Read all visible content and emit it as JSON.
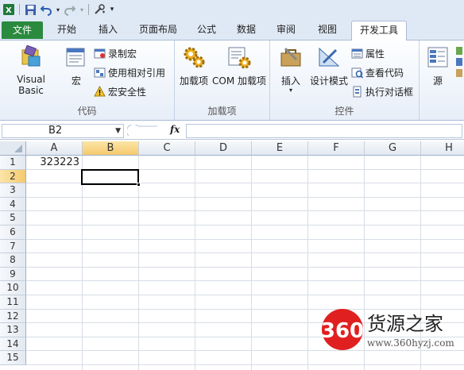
{
  "qat": {
    "icons": [
      "excel-icon",
      "save-icon",
      "undo-icon",
      "redo-icon",
      "customize-icon"
    ]
  },
  "tabs": [
    {
      "label": "文件"
    },
    {
      "label": "开始"
    },
    {
      "label": "插入"
    },
    {
      "label": "页面布局"
    },
    {
      "label": "公式"
    },
    {
      "label": "数据"
    },
    {
      "label": "审阅"
    },
    {
      "label": "视图"
    },
    {
      "label": "开发工具"
    }
  ],
  "ribbon": {
    "code_group": {
      "label": "代码",
      "visual_basic": "Visual Basic",
      "macros": "宏",
      "record_macro": "录制宏",
      "relative_refs": "使用相对引用",
      "macro_security": "宏安全性"
    },
    "addins_group": {
      "label": "加载项",
      "addins": "加载项",
      "com_addins": "COM 加载项"
    },
    "controls_group": {
      "label": "控件",
      "insert": "插入",
      "design_mode": "设计模式",
      "properties": "属性",
      "view_code": "查看代码",
      "run_dialog": "执行对话框"
    },
    "xml_group": {
      "source": "源"
    }
  },
  "formula_bar": {
    "name_box": "B2",
    "fx": "fx",
    "formula": ""
  },
  "grid": {
    "columns": [
      "A",
      "B",
      "C",
      "D",
      "E",
      "F",
      "G",
      "H"
    ],
    "rows": [
      "1",
      "2",
      "3",
      "4",
      "5",
      "6",
      "7",
      "8",
      "9",
      "10",
      "11",
      "12",
      "13",
      "14",
      "15"
    ],
    "selected_column": "B",
    "selected_row": "2",
    "cells": {
      "A1": "323223"
    }
  },
  "watermark": {
    "logo": "360",
    "brand": "货源之家",
    "url": "www.360hyzj.com"
  },
  "colors": {
    "file_tab": "#2a8a3e",
    "selection_header": "#f5c96e",
    "watermark_red": "#e02020"
  }
}
